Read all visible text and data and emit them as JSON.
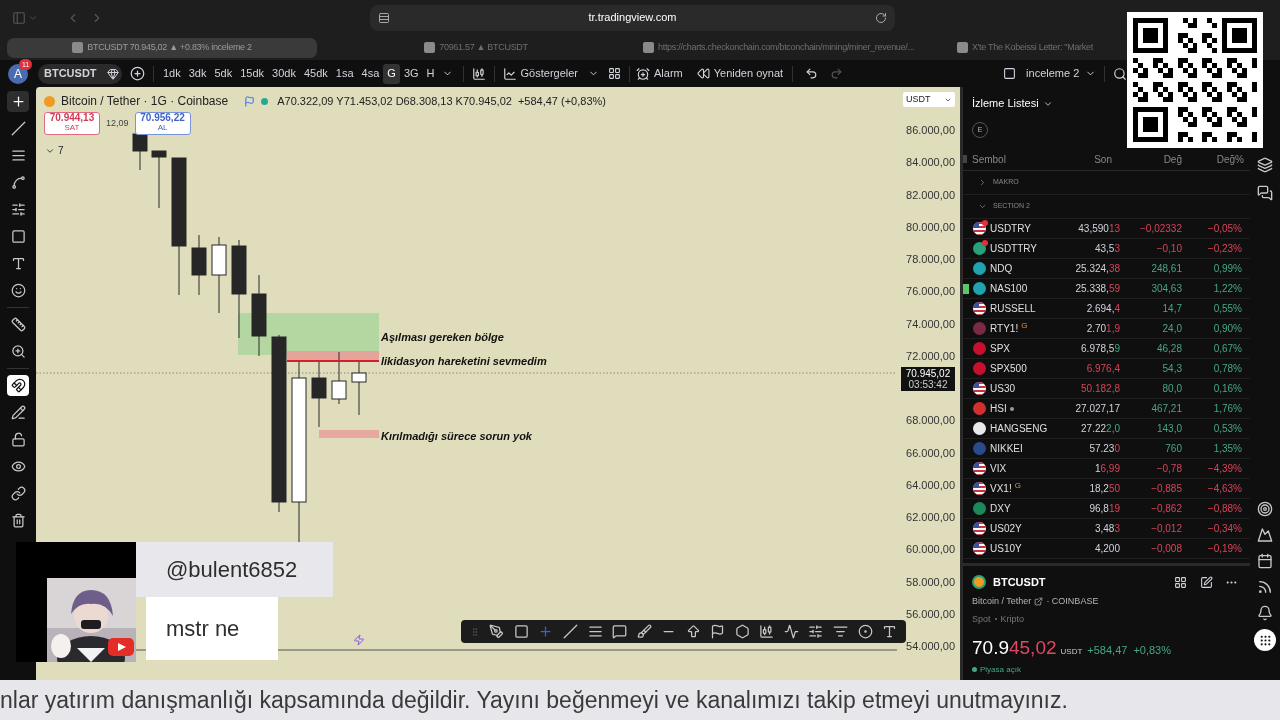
{
  "browser": {
    "url": "tr.tradingview.com",
    "tabs": [
      {
        "title": "BTCUSDT 70.945,02 ▲ +0.83% inceleme 2",
        "selected": true
      },
      {
        "title": "70961.57 ▲ BTCUSDT",
        "selected": false
      },
      {
        "title": "https://charts.checkonchain.com/btconchain/mining/miner_revenue/...",
        "selected": false
      },
      {
        "title": "X'te The Kobeissi Letter: \"Market",
        "selected": false
      }
    ]
  },
  "toolbar": {
    "avatar": "A",
    "notifications": "11",
    "symbol": "BTCUSDT",
    "intervals": [
      {
        "label": "1dk",
        "selected": false
      },
      {
        "label": "3dk",
        "selected": false
      },
      {
        "label": "5dk",
        "selected": false
      },
      {
        "label": "15dk",
        "selected": false
      },
      {
        "label": "30dk",
        "selected": false
      },
      {
        "label": "45dk",
        "selected": false
      },
      {
        "label": "1sa",
        "selected": false
      },
      {
        "label": "4sa",
        "selected": false
      },
      {
        "label": "G",
        "selected": true
      },
      {
        "label": "3G",
        "selected": false
      },
      {
        "label": "H",
        "selected": false
      }
    ],
    "indicators": "Göstergeler",
    "alert": "Alarm",
    "replay": "Yeniden oynat",
    "layout": "inceleme 2"
  },
  "left_tools": [
    {
      "kind": "crosshair",
      "selected": true
    },
    {
      "kind": "trendline",
      "selected": false
    },
    {
      "kind": "lines",
      "selected": false
    },
    {
      "kind": "pattern",
      "selected": false
    },
    {
      "kind": "fib",
      "selected": false
    },
    {
      "kind": "rectangle",
      "selected": false
    },
    {
      "kind": "text",
      "selected": false
    },
    {
      "kind": "emoji",
      "selected": false
    },
    {
      "kind": "ruler",
      "selected": false
    },
    {
      "kind": "zoom",
      "selected": false
    },
    {
      "kind": "magnet",
      "selected": true
    },
    {
      "kind": "pencil",
      "selected": false
    },
    {
      "kind": "lock",
      "selected": false
    },
    {
      "kind": "eye",
      "selected": false
    },
    {
      "kind": "link",
      "selected": false
    },
    {
      "kind": "trash",
      "selected": false
    }
  ],
  "chart": {
    "legend": {
      "title": "Bitcoin / Tether · 1G · Coinbase",
      "ohlc": [
        "A70.322,09",
        "Y71.453,02",
        "D68.308,13",
        "K70.945,02"
      ],
      "change": "+584,47 (+0,83%)"
    },
    "sell": {
      "price": "70.944,13",
      "label": "SAT"
    },
    "spread": "12,09",
    "buy": {
      "price": "70.956,22",
      "label": "AL"
    },
    "indicators_count": "7",
    "currency": "USDT",
    "annotations": [
      "Aşılması gereken bölge",
      "likidasyon hareketini sevmedim",
      "Kırılmadığı sürece sorun yok"
    ],
    "price_scale": [
      {
        "kind": "tick",
        "label": "86.000,00"
      },
      {
        "kind": "tick",
        "label": "84.000,00"
      },
      {
        "kind": "tick",
        "label": "82.000,00"
      },
      {
        "kind": "tick",
        "label": "80.000,00"
      },
      {
        "kind": "tick",
        "label": "78.000,00"
      },
      {
        "kind": "tick",
        "label": "76.000,00"
      },
      {
        "kind": "tick",
        "label": "74.000,00"
      },
      {
        "kind": "tick",
        "label": "72.000,00"
      },
      {
        "kind": "current",
        "label": "70.945,02",
        "countdown": "03:53:42"
      },
      {
        "kind": "tick",
        "label": "68.000,00"
      },
      {
        "kind": "tick",
        "label": "66.000,00"
      },
      {
        "kind": "tick",
        "label": "64.000,00"
      },
      {
        "kind": "tick",
        "label": "62.000,00"
      },
      {
        "kind": "tick",
        "label": "60.000,00"
      },
      {
        "kind": "tick",
        "label": "58.000,00"
      },
      {
        "kind": "tick",
        "label": "56.000,00"
      },
      {
        "kind": "tick",
        "label": "54.000,00"
      }
    ],
    "drawing_tools": [
      {
        "kind": "grip",
        "selected": false
      },
      {
        "kind": "brushline",
        "selected": false
      },
      {
        "kind": "rectangle",
        "selected": false
      },
      {
        "kind": "crosshair",
        "selected": true
      },
      {
        "kind": "line",
        "selected": false
      },
      {
        "kind": "lines",
        "selected": false
      },
      {
        "kind": "callout",
        "selected": false
      },
      {
        "kind": "brush",
        "selected": false
      },
      {
        "kind": "hline",
        "selected": false
      },
      {
        "kind": "arrow",
        "selected": false
      },
      {
        "kind": "flag",
        "selected": false
      },
      {
        "kind": "polygon",
        "selected": false
      },
      {
        "kind": "candles",
        "selected": false
      },
      {
        "kind": "path",
        "selected": false
      },
      {
        "kind": "sliders",
        "selected": false
      },
      {
        "kind": "filter",
        "selected": false
      },
      {
        "kind": "circle",
        "selected": false
      },
      {
        "kind": "text",
        "selected": false
      }
    ]
  },
  "watchlist": {
    "title": "İzleme Listesi",
    "filter": "E",
    "columns": [
      "Sembol",
      "Son",
      "Değ",
      "Değ%"
    ],
    "sections": [
      {
        "name": "MAKRO",
        "expanded": false
      },
      {
        "name": "SECTION 2",
        "expanded": true,
        "rows": [
          {
            "kind": "flag",
            "symbol": "USDTRY",
            "last": "43,590",
            "last_tail": "13",
            "tail_up": false,
            "change": "−0,02332",
            "change_pct": "−0,05%",
            "up": false,
            "alert": true,
            "marked": false,
            "session_dot": false
          },
          {
            "kind": "coin",
            "color": "#26a17b",
            "symbol": "USDTTRY",
            "last": "43,5",
            "last_tail": "3",
            "tail_up": false,
            "change": "−0,10",
            "change_pct": "−0,23%",
            "up": false,
            "alert": true,
            "marked": false,
            "session_dot": false
          },
          {
            "kind": "coin",
            "color": "#1fa3b0",
            "symbol": "NDQ",
            "last": "25.324,",
            "last_tail": "38",
            "tail_up": false,
            "change": "248,61",
            "change_pct": "0,99%",
            "up": true,
            "alert": false,
            "marked": false,
            "session_dot": false
          },
          {
            "kind": "coin",
            "color": "#1fa3b0",
            "symbol": "NAS100",
            "last": "25.338,",
            "last_tail": "59",
            "tail_up": false,
            "change": "304,63",
            "change_pct": "1,22%",
            "up": true,
            "alert": false,
            "marked": true,
            "session_dot": false
          },
          {
            "kind": "flag",
            "symbol": "RUSSELL",
            "last": "2.694,",
            "last_tail": "4",
            "tail_up": false,
            "change": "14,7",
            "change_pct": "0,55%",
            "up": true,
            "alert": false,
            "marked": false,
            "session_dot": false
          },
          {
            "kind": "coin",
            "color": "#7a2a44",
            "symbol": "RTY1!",
            "sup": "G",
            "last": "2.70",
            "last_tail": "1,9",
            "tail_up": false,
            "change": "24,0",
            "change_pct": "0,90%",
            "up": true,
            "alert": false,
            "marked": false,
            "session_dot": false
          },
          {
            "kind": "coin",
            "color": "#c8102e",
            "symbol": "SPX",
            "last": "6.978,5",
            "last_tail": "9",
            "tail_up": true,
            "change": "46,28",
            "change_pct": "0,67%",
            "up": true,
            "alert": false,
            "marked": false,
            "session_dot": false
          },
          {
            "kind": "coin",
            "color": "#c8102e",
            "symbol": "SPX500",
            "last_tail": "6.976,4",
            "tail_up": false,
            "change": "54,3",
            "change_pct": "0,78%",
            "up": true,
            "alert": false,
            "marked": false,
            "session_dot": false
          },
          {
            "kind": "flag",
            "symbol": "US30",
            "last_tail": "50.182,8",
            "tail_up": false,
            "change": "80,0",
            "change_pct": "0,16%",
            "up": true,
            "alert": false,
            "marked": false,
            "session_dot": false
          },
          {
            "kind": "coin",
            "color": "#d32f2f",
            "symbol": "HSI",
            "last": "27.027,17",
            "change": "467,21",
            "change_pct": "1,76%",
            "up": true,
            "alert": false,
            "marked": false,
            "session_dot": true
          },
          {
            "kind": "coin",
            "color": "#e8e8e8",
            "symbol": "HANGSENG",
            "last": "27.22",
            "last_tail": "2,0",
            "tail_up": true,
            "change": "143,0",
            "change_pct": "0,53%",
            "up": true,
            "alert": false,
            "marked": false,
            "session_dot": false
          },
          {
            "kind": "coin",
            "color": "#2b4a8b",
            "symbol": "NIKKEI",
            "last": "57.23",
            "last_tail": "0",
            "tail_up": false,
            "change": "760",
            "change_pct": "1,35%",
            "up": true,
            "alert": false,
            "marked": false,
            "session_dot": false
          },
          {
            "kind": "flag",
            "symbol": "VIX",
            "last": "1",
            "last_tail": "6,99",
            "tail_up": false,
            "change": "−0,78",
            "change_pct": "−4,39%",
            "up": false,
            "alert": false,
            "marked": false,
            "session_dot": false
          },
          {
            "kind": "flag",
            "symbol": "VX1!",
            "sup": "G",
            "last": "18,2",
            "last_tail": "50",
            "tail_up": false,
            "change": "−0,885",
            "change_pct": "−4,63%",
            "up": false,
            "alert": false,
            "marked": false,
            "session_dot": false
          },
          {
            "kind": "coin",
            "color": "#1b8a5a",
            "symbol": "DXY",
            "last": "96,8",
            "last_tail": "19",
            "tail_up": false,
            "change": "−0,862",
            "change_pct": "−0,88%",
            "up": false,
            "alert": false,
            "marked": false,
            "session_dot": false
          },
          {
            "kind": "flag",
            "symbol": "US02Y",
            "last": "3,48",
            "last_tail": "3",
            "tail_up": false,
            "change": "−0,012",
            "change_pct": "−0,34%",
            "up": false,
            "alert": false,
            "marked": false,
            "session_dot": false
          },
          {
            "kind": "flag",
            "symbol": "US10Y",
            "last": "4,200",
            "change": "−0,008",
            "change_pct": "−0,19%",
            "up": false,
            "alert": false,
            "marked": false,
            "session_dot": false
          }
        ]
      }
    ]
  },
  "details": {
    "symbol": "BTCUSDT",
    "name": "Bitcoin / Tether",
    "exchange": "· COINBASE",
    "tags": [
      "Spot",
      "Kripto"
    ],
    "price": "70.9",
    "price_tail": "45,02",
    "currency": "USDT",
    "change": "+584,47",
    "change_pct": "+0,83%",
    "status": "Piyasa açık",
    "market_open": true
  },
  "stream": {
    "chat": {
      "user": "@bulent6852",
      "message": "mstr ne"
    },
    "ticker": "nlar yatırım danışmanlığı kapsamında değildir. Yayını beğenmeyi ve kanalımızı takip etmeyi unutmayınız."
  }
}
